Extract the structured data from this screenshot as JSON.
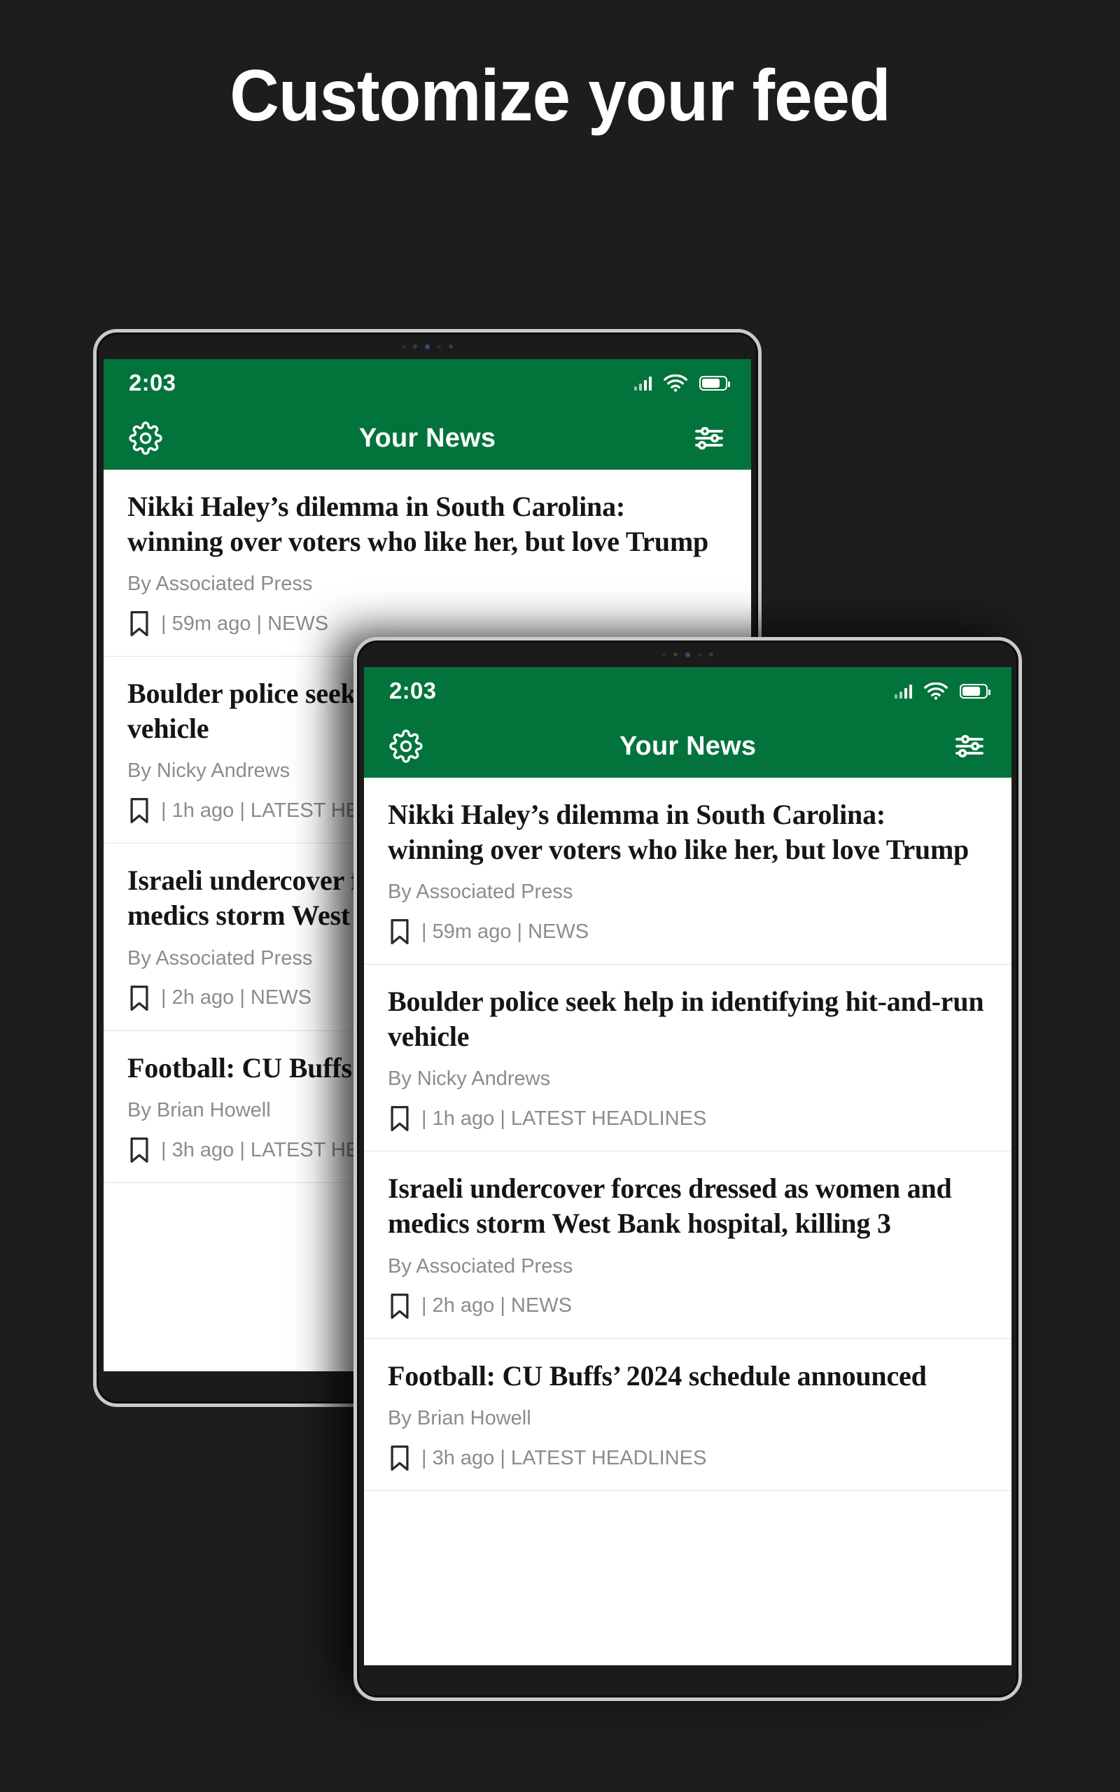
{
  "headline": "Customize your feed",
  "theme": {
    "background": "#1e1d1d",
    "brand_green": "#03733c",
    "headline_text": "#151515",
    "meta_text": "#8c8c8c"
  },
  "app": {
    "status_bar": {
      "time": "2:03",
      "icons": [
        "signal-icon",
        "wifi-icon",
        "battery-icon"
      ]
    },
    "app_bar": {
      "title": "Your News",
      "left_icon": "gear-icon",
      "right_icon": "filter-sliders-icon"
    },
    "articles": [
      {
        "headline": "Nikki Haley’s dilemma in South Carolina: winning over voters who like her, but love Trump",
        "byline": "By Associated Press",
        "meta": "| 59m ago | NEWS",
        "bookmark_icon": "bookmark-icon"
      },
      {
        "headline": "Boulder police seek help in identifying hit-and-run vehicle",
        "byline": "By Nicky Andrews",
        "meta": "| 1h ago | LATEST HEADLINES",
        "bookmark_icon": "bookmark-icon"
      },
      {
        "headline": "Israeli undercover forces dressed as women and medics storm West Bank hospital, killing 3",
        "byline": "By Associated Press",
        "meta": "| 2h ago | NEWS",
        "bookmark_icon": "bookmark-icon"
      },
      {
        "headline": "Football: CU Buffs’ 2024 schedule announced",
        "byline": "By Brian Howell",
        "meta": "| 3h ago | LATEST HEADLINES",
        "bookmark_icon": "bookmark-icon"
      }
    ]
  }
}
